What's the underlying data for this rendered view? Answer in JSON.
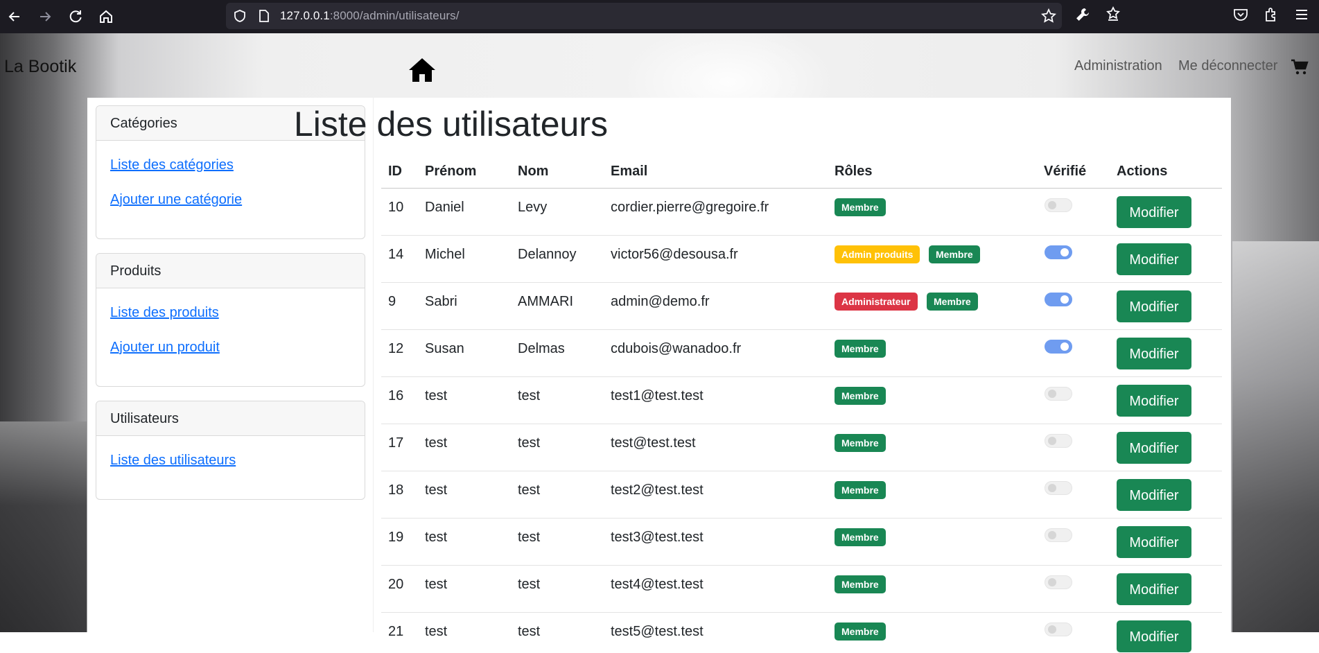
{
  "browser": {
    "url_host": "127.0.0.1",
    "url_rest": ":8000/admin/utilisateurs/"
  },
  "navbar": {
    "brand": "La Bootik",
    "links": [
      "Administration",
      "Me déconnecter"
    ]
  },
  "sidebar": {
    "cards": [
      {
        "title": "Catégories",
        "links": [
          "Liste des catégories",
          "Ajouter une catégorie"
        ]
      },
      {
        "title": "Produits",
        "links": [
          "Liste des produits",
          "Ajouter un produit"
        ]
      },
      {
        "title": "Utilisateurs",
        "links": [
          "Liste des utilisateurs"
        ]
      }
    ]
  },
  "main": {
    "title": "Liste des utilisateurs",
    "columns": [
      "ID",
      "Prénom",
      "Nom",
      "Email",
      "Rôles",
      "Vérifié",
      "Actions"
    ],
    "action_label": "Modifier",
    "rows": [
      {
        "id": "10",
        "prenom": "Daniel",
        "nom": "Levy",
        "email": "cordier.pierre@gregoire.fr",
        "roles": [
          "Membre"
        ],
        "verified": false
      },
      {
        "id": "14",
        "prenom": "Michel",
        "nom": "Delannoy",
        "email": "victor56@desousa.fr",
        "roles": [
          "Admin produits",
          "Membre"
        ],
        "verified": true
      },
      {
        "id": "9",
        "prenom": "Sabri",
        "nom": "AMMARI",
        "email": "admin@demo.fr",
        "roles": [
          "Administrateur",
          "Membre"
        ],
        "verified": true
      },
      {
        "id": "12",
        "prenom": "Susan",
        "nom": "Delmas",
        "email": "cdubois@wanadoo.fr",
        "roles": [
          "Membre"
        ],
        "verified": true
      },
      {
        "id": "16",
        "prenom": "test",
        "nom": "test",
        "email": "test1@test.test",
        "roles": [
          "Membre"
        ],
        "verified": false
      },
      {
        "id": "17",
        "prenom": "test",
        "nom": "test",
        "email": "test@test.test",
        "roles": [
          "Membre"
        ],
        "verified": false
      },
      {
        "id": "18",
        "prenom": "test",
        "nom": "test",
        "email": "test2@test.test",
        "roles": [
          "Membre"
        ],
        "verified": false
      },
      {
        "id": "19",
        "prenom": "test",
        "nom": "test",
        "email": "test3@test.test",
        "roles": [
          "Membre"
        ],
        "verified": false
      },
      {
        "id": "20",
        "prenom": "test",
        "nom": "test",
        "email": "test4@test.test",
        "roles": [
          "Membre"
        ],
        "verified": false
      },
      {
        "id": "21",
        "prenom": "test",
        "nom": "test",
        "email": "test5@test.test",
        "roles": [
          "Membre"
        ],
        "verified": false
      }
    ]
  },
  "colors": {
    "success": "#198754",
    "warning": "#ffc107",
    "danger": "#dc3545",
    "link": "#0d6efd",
    "toggle_on": "#6f9cf0"
  },
  "icons": [
    "back-icon",
    "forward-icon",
    "reload-icon",
    "home-icon",
    "shield-icon",
    "page-icon",
    "star-icon",
    "wrench-icon",
    "extension-star-icon",
    "pocket-icon",
    "extensions-icon",
    "menu-icon",
    "cart-icon"
  ]
}
